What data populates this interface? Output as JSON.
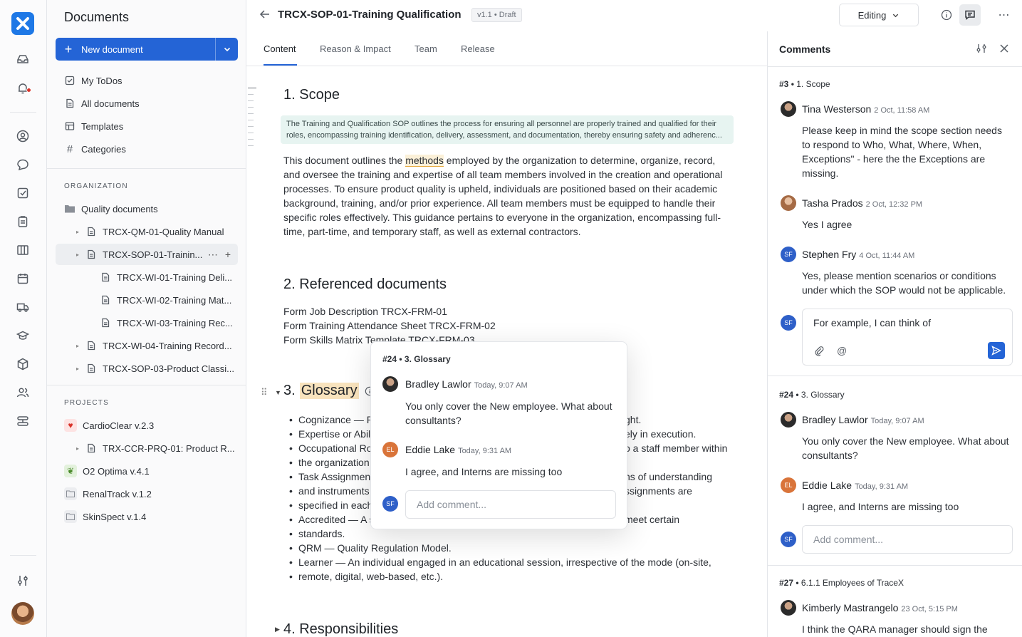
{
  "sidebar": {
    "title": "Documents",
    "new_doc_label": "New document",
    "nav": [
      "My ToDos",
      "All documents",
      "Templates",
      "Categories"
    ],
    "org_section": "ORGANIZATION",
    "org_items": [
      "Quality documents",
      "TRCX-QM-01-Quality Manual",
      "TRCX-SOP-01-Trainin...",
      "TRCX-WI-01-Training Deli...",
      "TRCX-WI-02-Training Mat...",
      "TRCX-WI-03-Training Rec...",
      "TRCX-WI-04-Training Record...",
      "TRCX-SOP-03-Product Classi..."
    ],
    "projects_section": "PROJECTS",
    "projects": [
      "CardioClear v.2.3",
      "TRX-CCR-PRQ-01: Product R...",
      "O2 Optima v.4.1",
      "RenalTrack v.1.2",
      "SkinSpect v.1.4"
    ]
  },
  "header": {
    "title": "TRCX-SOP-01-Training Qualification",
    "version": "v1.1 • Draft",
    "mode": "Editing"
  },
  "tabs": [
    "Content",
    "Reason & Impact",
    "Team",
    "Release"
  ],
  "doc": {
    "scope_heading": "1. Scope",
    "ai_summary": "The Training and Qualification SOP outlines the process for ensuring all personnel are properly trained and qualified for their roles, encompassing training identification, delivery, assessment, and documentation, thereby ensuring safety and adherenc...",
    "scope_lines": [
      [
        "This document outlines the ",
        "methods",
        " employed by the organization to determine, organize, record,"
      ],
      "and oversee the training and expertise of all team members involved in the creation and operational",
      "processes. To ensure product quality is upheld, individuals are positioned based on their academic",
      "background, training, and/or prior experience. All team members must be equipped to handle their",
      "specific roles effectively. This guidance pertains to everyone in the organization, encompassing full-",
      "time, part-time, and temporary staff, as well as external contractors."
    ],
    "refs_heading": "2. Referenced documents",
    "refs": [
      "Form Job Description TRCX-FRM-01",
      "Form Training Attendance Sheet TRCX-FRM-02",
      "Form Skills Matrix Template TRCX-FRM-03"
    ],
    "glossary_num": "3.",
    "glossary_word": "Glossary",
    "glossary": [
      [
        "Cognizance — Po",
        "ght."
      ],
      [
        "Expertise or Abil",
        "ely in execution."
      ],
      [
        "Occupational Ro",
        "o a staff member within"
      ],
      [
        "the organization",
        ""
      ],
      [
        "Task Assignmen",
        "ns of understanding"
      ],
      [
        "and instruments",
        "ssignments are"
      ],
      [
        "specified in each",
        ""
      ],
      [
        "Accredited — A s",
        "meet certain"
      ],
      [
        "standards.",
        ""
      ],
      [
        "QRM — Quality Regulation Model.",
        ""
      ],
      [
        "Learner — An individual engaged in an educational session, irrespective of the mode (on-site,",
        ""
      ],
      [
        "remote, digital, web-based, etc.).",
        ""
      ]
    ],
    "resp_heading": "4. Responsibilities"
  },
  "popup": {
    "ref": "#24",
    "section": "3. Glossary",
    "comments": [
      {
        "initials": "",
        "name": "Bradley Lawlor",
        "time": "Today, 9:07 AM",
        "body": [
          "You only cover the New employee. What about",
          "consultants?"
        ]
      },
      {
        "initials": "EL",
        "name": "Eddie Lake",
        "time": "Today, 9:31 AM",
        "body": [
          "I agree, and Interns are missing too"
        ]
      }
    ],
    "me_initials": "SF",
    "placeholder": "Add comment..."
  },
  "comments_panel": {
    "title": "Comments",
    "threads": [
      {
        "ref": "#3",
        "section": "1. Scope",
        "comments": [
          {
            "initials": "",
            "name": "Tina Westerson",
            "time": "2 Oct, 11:58 AM",
            "body": [
              "Please keep in mind the scope section needs",
              "to respond to Who, What, Where, When,",
              "Exceptions\" - here the the Exceptions are",
              "missing."
            ]
          },
          {
            "initials": "",
            "name": "Tasha Prados",
            "time": "2 Oct, 12:32 PM",
            "body": [
              "Yes I agree"
            ]
          },
          {
            "initials": "SF",
            "name": "Stephen Fry",
            "time": "4 Oct, 11:44 AM",
            "body": [
              "Yes, please mention scenarios or conditions",
              "under which the SOP would not be applicable."
            ]
          }
        ],
        "draft": "For example, I can think of"
      },
      {
        "ref": "#24",
        "section": "3. Glossary",
        "comments": [
          {
            "initials": "",
            "name": "Bradley Lawlor",
            "time": "Today, 9:07 AM",
            "body": [
              "You only cover the New employee. What about",
              "consultants?"
            ]
          },
          {
            "initials": "EL",
            "name": "Eddie Lake",
            "time": "Today, 9:31 AM",
            "body": [
              "I agree, and Interns are missing too"
            ]
          }
        ],
        "placeholder": "Add comment..."
      },
      {
        "ref": "#27",
        "section": "6.1.1 Employees of TraceX",
        "comments": [
          {
            "initials": "",
            "name": "Kimberly Mastrangelo",
            "time": "23 Oct, 5:15 PM",
            "body": [
              "I think the QARA manager should sign the"
            ]
          }
        ]
      }
    ]
  },
  "colors": {
    "accent": "#2464d6",
    "highlight": "#f8e3bd",
    "ai_box": "#e7f4f1",
    "initials_sf": "#2e5fc8",
    "initials_el": "#d9743a"
  },
  "me_initials": "SF"
}
